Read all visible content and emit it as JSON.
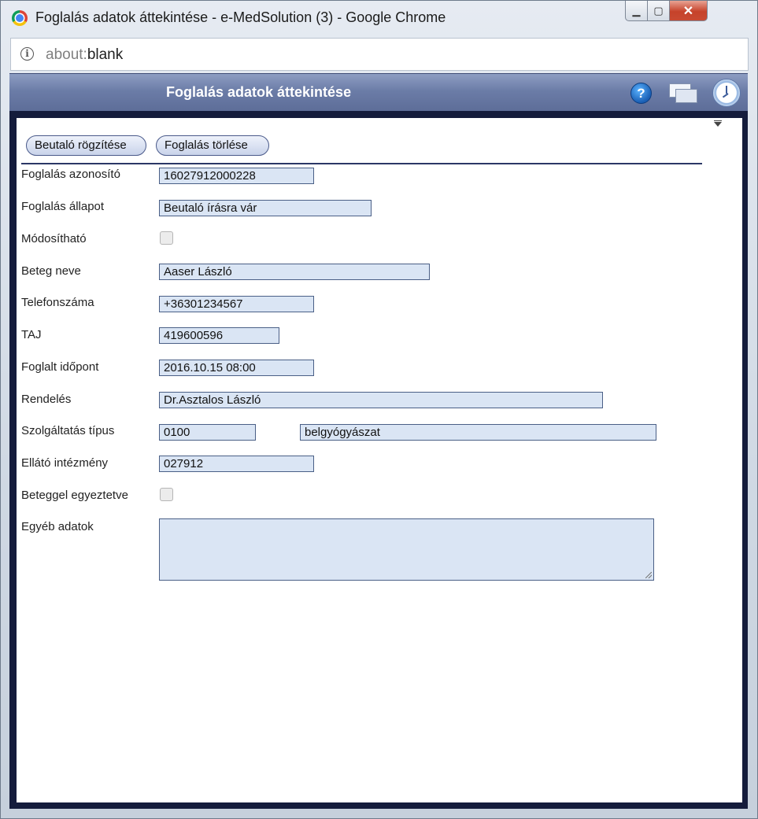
{
  "window": {
    "title": "Foglalás adatok áttekintése - e-MedSolution (3) - Google Chrome",
    "controls": {
      "minimize": "▁",
      "maximize": "▢",
      "close": "✕"
    }
  },
  "address": {
    "scheme": "about:",
    "path": "blank"
  },
  "header": {
    "title": "Foglalás adatok áttekintése",
    "help_glyph": "?",
    "icons": [
      "help-icon",
      "windows-icon",
      "clock-icon"
    ]
  },
  "toolbar": {
    "referral_button": "Beutaló rögzítése",
    "delete_button": "Foglalás törlése"
  },
  "form": {
    "booking_id": {
      "label": "Foglalás azonosító",
      "value": "16027912000228"
    },
    "booking_status": {
      "label": "Foglalás állapot",
      "value": "Beutaló írásra vár"
    },
    "modifiable": {
      "label": "Módosítható",
      "checked": false
    },
    "patient_name": {
      "label": "Beteg neve",
      "value": "Aaser László"
    },
    "phone": {
      "label": "Telefonszáma",
      "value": "+36301234567"
    },
    "taj": {
      "label": "TAJ",
      "value": "419600596"
    },
    "booked_time": {
      "label": "Foglalt időpont",
      "value": "2016.10.15 08:00"
    },
    "clinic": {
      "label": "Rendelés",
      "value": "Dr.Asztalos László"
    },
    "service_type": {
      "label": "Szolgáltatás típus",
      "code": "0100",
      "name": "belgyógyászat"
    },
    "institution": {
      "label": "Ellátó intézmény",
      "value": "027912"
    },
    "agreed_with_patient": {
      "label": "Beteggel egyeztetve",
      "checked": false
    },
    "other_data": {
      "label": "Egyéb adatok",
      "value": ""
    }
  },
  "colors": {
    "header_bg": "#6b7ca7",
    "frame_dark": "#141c3c",
    "field_bg": "#dae5f4",
    "field_border": "#4a5f86"
  }
}
